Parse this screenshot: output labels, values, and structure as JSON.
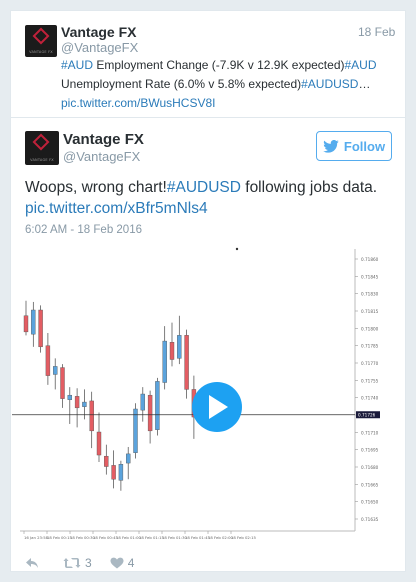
{
  "tweet1": {
    "name": "Vantage FX",
    "handle": "@VantageFX",
    "date": "18 Feb",
    "line1_hashtag_a": "#AUD",
    "line1_text": " Employment Change (-7.9K v 12.9K expected)",
    "line1_hashtag_b": "#AUD",
    "line2_text": "Unemployment Rate (6.0% v 5.8% expected)",
    "line2_hashtag": "#AUDUSD",
    "line2_ellipsis": "…",
    "link": "pic.twitter.com/BWusHCSV8I",
    "avatar_text": "VANTAGE FX"
  },
  "tweet2": {
    "name": "Vantage FX",
    "handle": "@VantageFX",
    "follow_label": "Follow",
    "text_before": "Woops, wrong chart!",
    "hashtag": "#AUDUSD",
    "text_after": " following jobs data.",
    "link": "pic.twitter.com/xBfr5mNls4",
    "timestamp": "6:02 AM - 18 Feb 2016",
    "avatar_text": "VANTAGE FX",
    "actions": {
      "retweets": "3",
      "likes": "4"
    }
  },
  "colors": {
    "link": "#2b7bb9",
    "follow": "#55acee",
    "bull": "#5ba3dc",
    "bear": "#e35d63",
    "play": "#1da1f2"
  },
  "chart_data": {
    "type": "candlestick",
    "current_price_label": "0.71726",
    "y_ticks": [
      "0.71860",
      "0.71845",
      "0.71830",
      "0.71815",
      "0.71800",
      "0.71785",
      "0.71770",
      "0.71755",
      "0.71740",
      "0.71725",
      "0.71710",
      "0.71695",
      "0.71680",
      "0.71665",
      "0.71650",
      "0.71635"
    ],
    "x_ticks": [
      "16 Jan 23:58",
      "18 Feb 00:15",
      "18 Feb 00:30",
      "18 Feb 00:45",
      "18 Feb 01:00",
      "18 Feb 01:15",
      "18 Feb 01:30",
      "18 Feb 01:45",
      "18 Feb 02:00",
      "18 Feb 02:15"
    ],
    "ylim": [
      0.71625,
      0.7187
    ],
    "candles": [
      {
        "o": 0.71812,
        "h": 0.71825,
        "l": 0.71795,
        "c": 0.71798
      },
      {
        "o": 0.71796,
        "h": 0.71824,
        "l": 0.71785,
        "c": 0.71817
      },
      {
        "o": 0.71817,
        "h": 0.71821,
        "l": 0.7178,
        "c": 0.71785
      },
      {
        "o": 0.71786,
        "h": 0.71797,
        "l": 0.71752,
        "c": 0.7176
      },
      {
        "o": 0.71761,
        "h": 0.71775,
        "l": 0.71748,
        "c": 0.71768
      },
      {
        "o": 0.71767,
        "h": 0.7177,
        "l": 0.71732,
        "c": 0.7174
      },
      {
        "o": 0.71739,
        "h": 0.7175,
        "l": 0.71718,
        "c": 0.71743
      },
      {
        "o": 0.71742,
        "h": 0.71749,
        "l": 0.71715,
        "c": 0.71732
      },
      {
        "o": 0.71733,
        "h": 0.71748,
        "l": 0.71722,
        "c": 0.71737
      },
      {
        "o": 0.71738,
        "h": 0.71746,
        "l": 0.71697,
        "c": 0.71712
      },
      {
        "o": 0.71711,
        "h": 0.71728,
        "l": 0.71685,
        "c": 0.71691
      },
      {
        "o": 0.7169,
        "h": 0.717,
        "l": 0.71674,
        "c": 0.71681
      },
      {
        "o": 0.71682,
        "h": 0.71695,
        "l": 0.71662,
        "c": 0.7167
      },
      {
        "o": 0.71669,
        "h": 0.71686,
        "l": 0.7166,
        "c": 0.71683
      },
      {
        "o": 0.71684,
        "h": 0.71698,
        "l": 0.7167,
        "c": 0.71692
      },
      {
        "o": 0.71693,
        "h": 0.71736,
        "l": 0.71688,
        "c": 0.71731
      },
      {
        "o": 0.7173,
        "h": 0.7175,
        "l": 0.7172,
        "c": 0.71744
      },
      {
        "o": 0.71743,
        "h": 0.71747,
        "l": 0.71701,
        "c": 0.71712
      },
      {
        "o": 0.71713,
        "h": 0.71758,
        "l": 0.71708,
        "c": 0.71755
      },
      {
        "o": 0.71754,
        "h": 0.71803,
        "l": 0.71748,
        "c": 0.7179
      },
      {
        "o": 0.71789,
        "h": 0.71806,
        "l": 0.71768,
        "c": 0.71774
      },
      {
        "o": 0.71775,
        "h": 0.71812,
        "l": 0.7177,
        "c": 0.71795
      },
      {
        "o": 0.71795,
        "h": 0.718,
        "l": 0.7174,
        "c": 0.71748
      },
      {
        "o": 0.71748,
        "h": 0.7176,
        "l": 0.71705,
        "c": 0.71724
      }
    ]
  }
}
